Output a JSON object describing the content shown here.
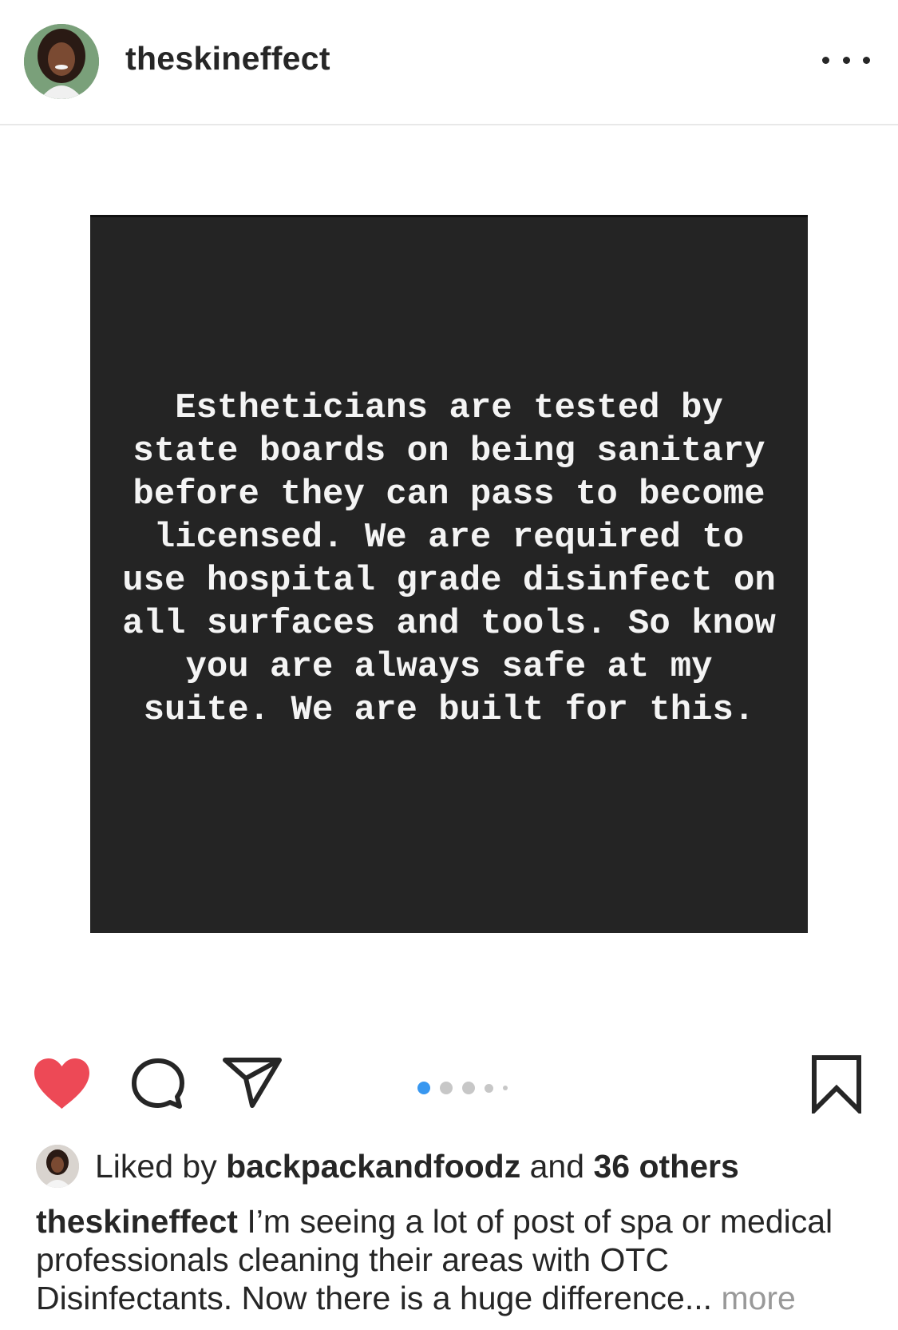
{
  "header": {
    "username": "theskineffect",
    "avatar_icon": "profile-photo-icon",
    "more_icon": "more-options-icon"
  },
  "post": {
    "image_text": "Estheticians are tested by state boards on being sanitary before they can pass to become licensed. We are required to use hospital grade disinfect on all surfaces and tools. So know you are always safe at my suite. We are built for this.",
    "card_color": "#242424",
    "text_color": "#f4f4f4"
  },
  "actions": {
    "like_icon": "heart-filled-icon",
    "comment_icon": "comment-icon",
    "share_icon": "direct-share-icon",
    "save_icon": "bookmark-icon",
    "like_color": "#ed4956",
    "carousel": {
      "current": 1,
      "active_color": "#3897f0"
    }
  },
  "likes": {
    "prefix": "Liked by",
    "first_liker": "backpackandfoodz",
    "connector": "and",
    "others": "36 others"
  },
  "caption": {
    "username": "theskineffect",
    "text": "I’m seeing a lot of post of spa or medical professionals cleaning their areas with OTC Disinfectants. Now there is a huge difference...",
    "more_label": "more"
  }
}
